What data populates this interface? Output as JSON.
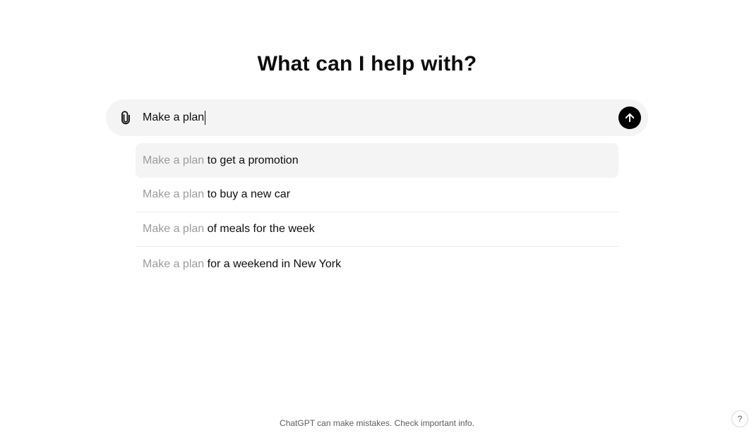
{
  "main": {
    "title": "What can I help with?"
  },
  "composer": {
    "value": "Make a plan",
    "attach_icon": "paperclip-icon",
    "send_icon": "arrow-up-icon"
  },
  "suggestions": [
    {
      "prefix": "Make a plan",
      "rest": "to get a promotion"
    },
    {
      "prefix": "Make a plan",
      "rest": "to buy a new car"
    },
    {
      "prefix": "Make a plan",
      "rest": "of meals for the week"
    },
    {
      "prefix": "Make a plan",
      "rest": "for a weekend in New York"
    }
  ],
  "footer": {
    "disclaimer": "ChatGPT can make mistakes. Check important info."
  },
  "help": {
    "label": "?"
  },
  "colors": {
    "composer_bg": "#f4f4f4",
    "send_button": "#000000",
    "suggestion_prefix": "#9b9b9b"
  }
}
